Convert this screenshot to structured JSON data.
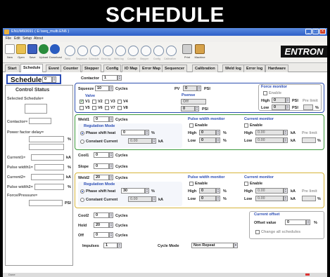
{
  "banner": {
    "title": "SCHEDULE"
  },
  "window": {
    "title": "ENUM60691 ( E:\\seq_multi.EN6 )",
    "min": "_",
    "max": "□",
    "close": "×"
  },
  "menu": [
    "File",
    "Edit",
    "Setup",
    "About"
  ],
  "toolbar": {
    "buttons": [
      "New",
      "Open",
      "Save",
      "Upload",
      "Download"
    ],
    "greyed": [
      "Weld",
      "Sequence",
      "Schedule",
      "Error log",
      "Weld log",
      "Counter",
      "Stepper",
      "Config",
      "Calibration"
    ],
    "print": "Print",
    "machine": "Machine",
    "logo": "ENTRON"
  },
  "tabs": [
    "Start",
    "Schedule",
    "Event",
    "Counter",
    "Stepper",
    "Config",
    "IO Map",
    "Error Map",
    "Sequencer",
    "Calibration",
    "Weld log",
    "Error log",
    "Hardware"
  ],
  "active_tab": "Schedule",
  "left": {
    "schedule_label": "Schedule",
    "schedule_value": "0",
    "control_status": "Control Status",
    "selected_schedule": "Selected Schedule=",
    "contactor": "Contactor=",
    "power_factor_delay": "Power factor delay=",
    "pct": "%",
    "current1": "Current1=",
    "kA1": "kA",
    "pulse_width1": "Pulse width1=",
    "pct1": "%",
    "current2": "Current2=",
    "kA2": "kA",
    "pulse_width2": "Pulse width2=",
    "pct2": "%",
    "force_pressure": "Force/Pressure=",
    "psi": "PSI"
  },
  "contactor": {
    "label": "Contactor",
    "value": "1"
  },
  "squeeze": {
    "label": "Squeeze",
    "value": "10",
    "unit": "Cycles"
  },
  "valve": {
    "title": "Valve",
    "items": [
      {
        "label": "V1",
        "on": true
      },
      {
        "label": "V2",
        "on": false
      },
      {
        "label": "V3",
        "on": false
      },
      {
        "label": "V4",
        "on": false
      },
      {
        "label": "V5",
        "on": false
      },
      {
        "label": "V6",
        "on": false
      },
      {
        "label": "V7",
        "on": false
      },
      {
        "label": "V8",
        "on": false
      }
    ]
  },
  "pv": {
    "label": "PV",
    "value": "0",
    "unit": "PSI"
  },
  "psense": {
    "title": "Psense",
    "select": "Off",
    "value": "0",
    "unit": "PSI"
  },
  "force_monitor": {
    "title": "Force monitor",
    "enable": "Enable",
    "high": "High",
    "high_val": "0",
    "high_unit": "PSI",
    "prelimit": "Pre limit",
    "low": "Low",
    "low_val": "0",
    "low_unit": "PSI",
    "pct": "%"
  },
  "weld1": {
    "label": "Weld1",
    "value": "0",
    "unit": "Cycles",
    "reg_title": "Regulation Mode",
    "phase": "Phase shift heat",
    "phase_val": "0",
    "phase_unit": "%",
    "const": "Constant Current",
    "const_val": "0.00",
    "const_unit": "kA",
    "pwm_title": "Pulse width monitor",
    "pwm_enable": "Enable",
    "pwm_high": "High",
    "pwm_high_val": "0",
    "pwm_high_unit": "%",
    "pwm_low": "Low",
    "pwm_low_val": "0",
    "pwm_low_unit": "%",
    "cm_title": "Current monitor",
    "cm_enable": "Enable",
    "cm_high": "High",
    "cm_high_val": "0.00",
    "cm_high_unit": "kA",
    "cm_prelimit": "Pre limit",
    "cm_low": "Low",
    "cm_low_val": "0.00",
    "cm_low_unit": "kA",
    "cm_pct": "%"
  },
  "cool1": {
    "label": "Cool1",
    "value": "0",
    "unit": "Cycles"
  },
  "slope": {
    "label": "Slope",
    "value": "0",
    "unit": "Cycles"
  },
  "weld2": {
    "label": "Weld2",
    "value": "20",
    "unit": "Cycles",
    "reg_title": "Regulation Mode",
    "phase": "Phase shift heat",
    "phase_val": "30",
    "phase_unit": "%",
    "const": "Constant Current",
    "const_val": "0.00",
    "const_unit": "kA",
    "pwm_title": "Pulse width monitor",
    "pwm_enable": "Enable",
    "pwm_high": "High",
    "pwm_high_val": "0",
    "pwm_high_unit": "%",
    "pwm_low": "Low",
    "pwm_low_val": "0",
    "pwm_low_unit": "%",
    "cm_title": "Current monitor",
    "cm_enable": "Enable",
    "cm_high": "High",
    "cm_high_val": "0.00",
    "cm_high_unit": "kA",
    "cm_prelimit": "Pre limit",
    "cm_low": "Low",
    "cm_low_val": "0.00",
    "cm_low_unit": "kA",
    "cm_pct": "%"
  },
  "cool2": {
    "label": "Cool2",
    "value": "0",
    "unit": "Cycles"
  },
  "hold": {
    "label": "Hold",
    "value": "20",
    "unit": "Cycles"
  },
  "off": {
    "label": "Off",
    "value": "0",
    "unit": "Cycles"
  },
  "impulses": {
    "label": "Impulses",
    "value": "1"
  },
  "cycle_mode": {
    "label": "Cycle Mode",
    "value": "Non Repeat"
  },
  "current_offset": {
    "title": "Current offset",
    "label": "Offset value",
    "value": "0",
    "unit": "%",
    "change_all": "Change all schedules"
  },
  "status": {
    "label": "Done"
  },
  "colors": {
    "group_blue": "#2d4fb0",
    "group_green": "#3c9a3c",
    "group_yellow": "#d6b43a",
    "title_blue": "#2a4cb4"
  }
}
